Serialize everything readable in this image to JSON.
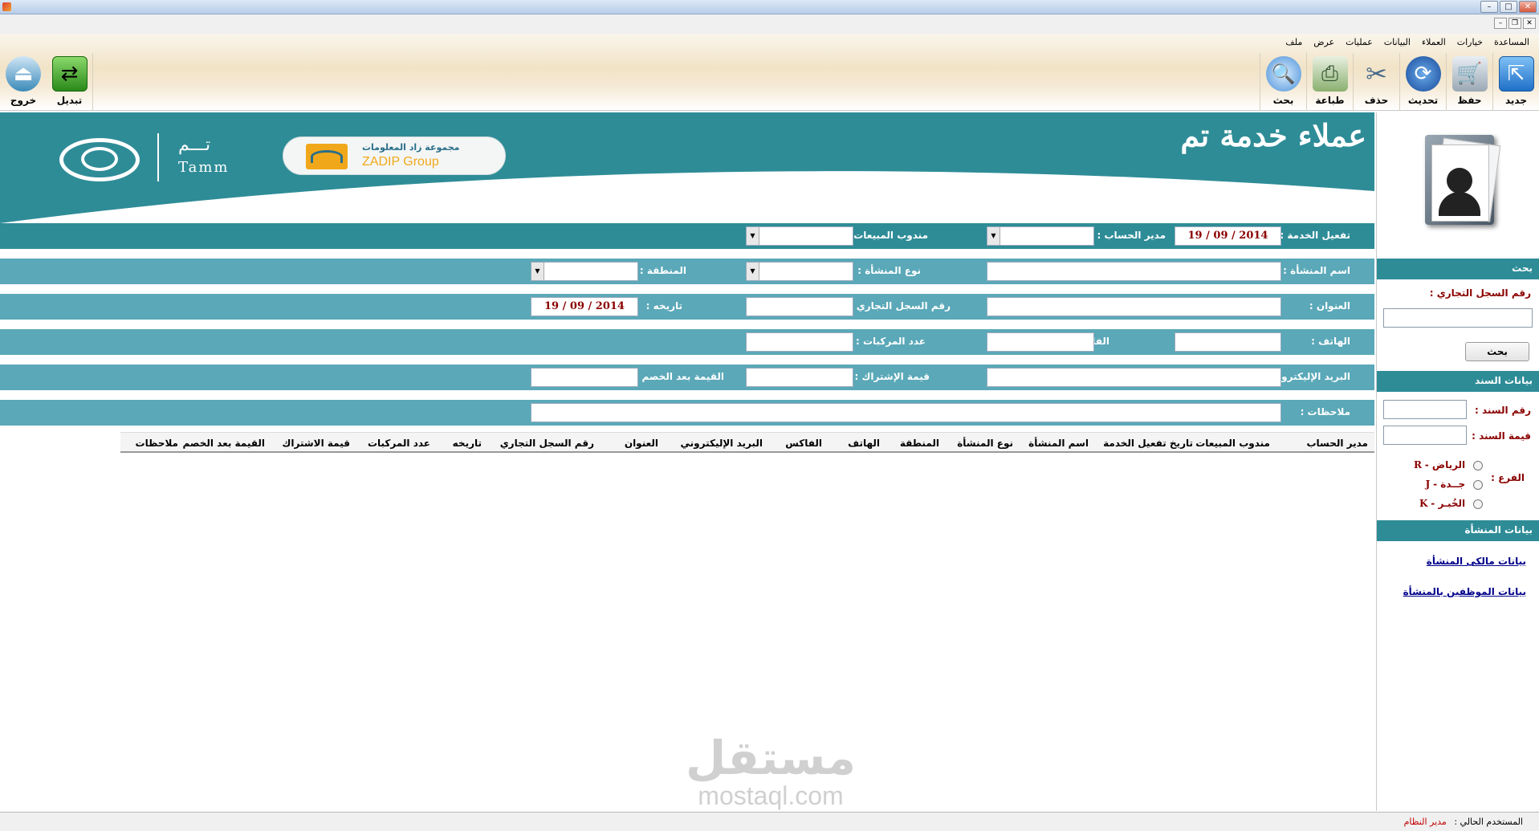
{
  "menu": [
    "ملف",
    "عرض",
    "عمليات",
    "البيانات",
    "العملاء",
    "خيارات",
    "المساعدة"
  ],
  "toolbar_right": [
    {
      "label": "جديد",
      "icon": "new-document-icon",
      "color": "#2f7fd8"
    },
    {
      "label": "حفظ",
      "icon": "cart-add-icon",
      "color": "#8a9aa8"
    },
    {
      "label": "تحديث",
      "icon": "refresh-icon",
      "color": "#1f5fb0"
    },
    {
      "label": "حذف",
      "icon": "scissors-icon",
      "color": "#5a7a9a"
    },
    {
      "label": "طباعة",
      "icon": "printer-icon",
      "color": "#70a050"
    },
    {
      "label": "بحث",
      "icon": "magnifier-icon",
      "color": "#3a8ad8"
    }
  ],
  "toolbar_left": [
    {
      "label": "تبديل",
      "icon": "swap-arrows-icon",
      "color": "#3c9a2a"
    },
    {
      "label": "خروج",
      "icon": "exit-icon",
      "color": "#3c8ab8"
    }
  ],
  "banner": {
    "title": "عملاء خدمة تم",
    "zadip_ar": "مجموعة زاد المعلومات",
    "zadip_en": "ZADIP Group",
    "tamm_ar": "تـــم",
    "tamm_en": "Tamm"
  },
  "form": {
    "service_activation_label": "تفعيل الخدمة :",
    "service_activation_date": "19  /  09  /  2014",
    "account_manager_label": "مدير الحساب :",
    "sales_rep_label": "مندوب المبيعات :",
    "company_name_label": "اسم المنشأة :",
    "company_type_label": "نوع المنشأة :",
    "region_label": "المنطقة :",
    "address_label": "العنوان :",
    "commercial_reg_label": "رقم السجل التجاري :",
    "its_date_label": "تاريخه :",
    "its_date_value": "19  /  09  /  2014",
    "phone_label": "الهاتف :",
    "fax_label": "الفاكس :",
    "vehicles_label": "عدد المركبات :",
    "email_label": "البريد الإليكتروني :",
    "subscription_label": "قيمة الإشتراك :",
    "after_discount_label": "القيمة بعد الخصم :",
    "notes_label": "ملاحظات :"
  },
  "grid_columns": [
    "مدير الحساب",
    "مندوب المبيعات",
    "تاريخ تفعيل الخدمة",
    "اسم المنشأة",
    "نوع المنشأة",
    "المنطقة",
    "الهاتف",
    "الفاكس",
    "البريد الإليكتروني",
    "العنوان",
    "رقم السجل التجاري",
    "تاريخه",
    "عدد المركبات",
    "قيمة الاشتراك",
    "القيمة بعد الخصم",
    "ملاحظات"
  ],
  "sidebar": {
    "search_header": "بحث",
    "commercial_reg_label": "رقم السجل التجاري :",
    "search_button": "بحث",
    "voucher_header": "بيانات السند",
    "voucher_number_label": "رقم السند :",
    "voucher_value_label": "قيمة السند :",
    "branch_label": "الفرع :",
    "branches": [
      {
        "name": "الرياض -",
        "code": "R"
      },
      {
        "name": "جــدة -",
        "code": "J"
      },
      {
        "name": "الخُبـر -",
        "code": "K"
      }
    ],
    "company_header": "بيانات المنشأة",
    "owners_link": "بيانات مالكى المنشأة",
    "employees_link": "بيانات الموظفين بالمنشأة"
  },
  "status": {
    "current_user_label": "المستخدم الحالي :",
    "current_user": "مدير النظام"
  },
  "watermark": {
    "arabic": "مستقل",
    "latin": "mostaql.com"
  },
  "colors": {
    "teal_dark": "#2e8c97",
    "teal_light": "#5aa8b8",
    "date_red": "#8b0000"
  }
}
